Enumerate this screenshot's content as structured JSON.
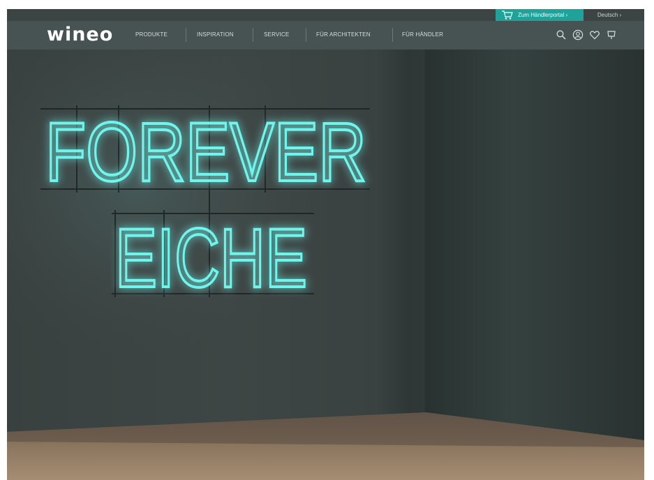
{
  "brand": {
    "logo_text": "wineo"
  },
  "topbar": {
    "portal_label": "Zum Händlerportal ›",
    "language_label": "Deutsch ›"
  },
  "nav": {
    "items": [
      {
        "label": "PRODUKTE"
      },
      {
        "label": "INSPIRATION"
      },
      {
        "label": "SERVICE"
      },
      {
        "label": "FÜR ARCHITEKTEN"
      },
      {
        "label": "FÜR HÄNDLER"
      }
    ],
    "icons": [
      "search-icon",
      "user-icon",
      "heart-icon",
      "cart-icon"
    ]
  },
  "hero": {
    "neon_line_1": "FOREVER",
    "neon_line_2": "EICHE"
  },
  "colors": {
    "accent": "#1fa29a",
    "neon": "#6ff5ec",
    "nav_bg": "#485454"
  }
}
